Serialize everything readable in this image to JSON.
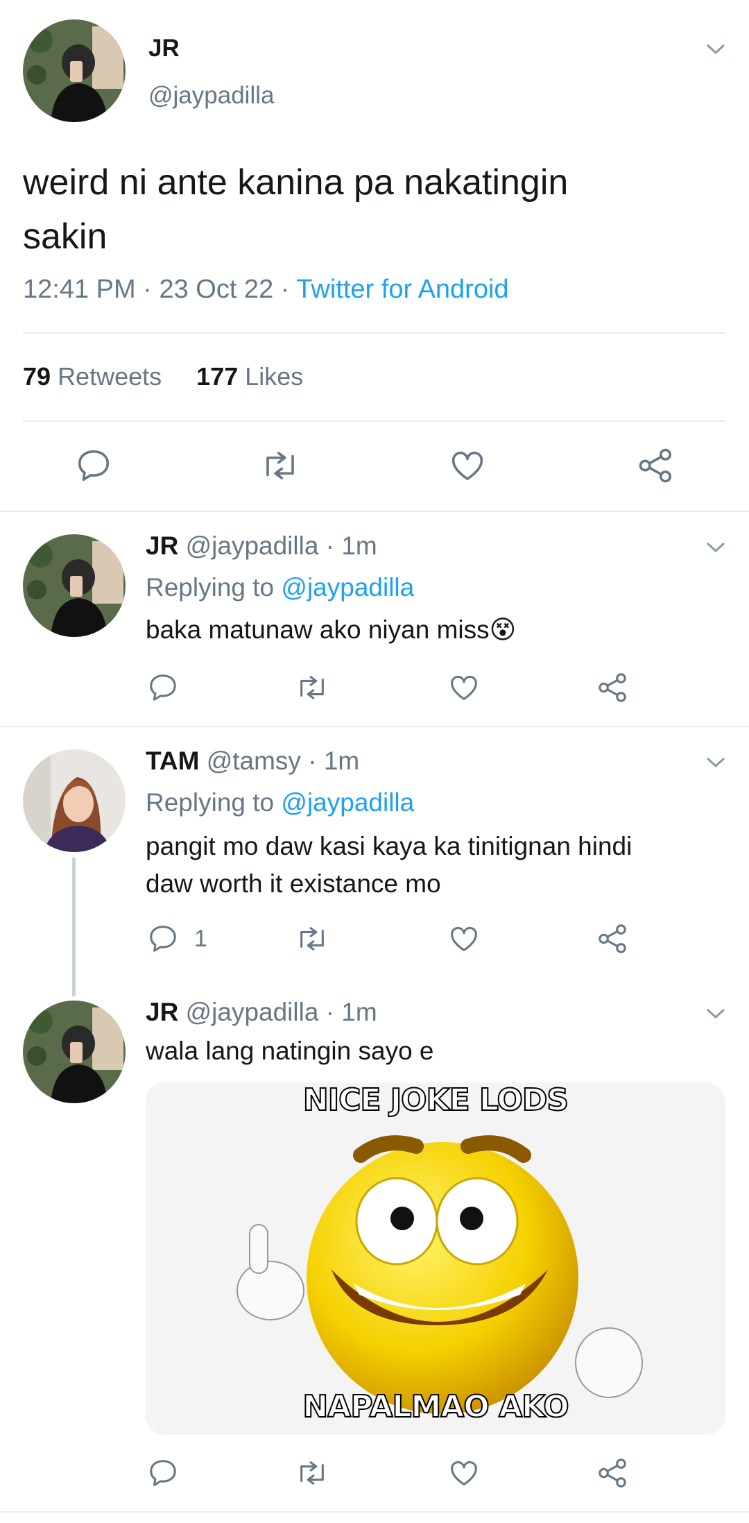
{
  "main_tweet": {
    "display_name": "JR",
    "handle": "@jaypadilla",
    "text_line1": "weird ni ante kanina pa nakatingin",
    "text_line2": "sakin",
    "time": "12:41 PM",
    "date": "23 Oct 22",
    "separator": "·",
    "source": "Twitter for Android",
    "retweets_count": "79",
    "retweets_label": "Retweets",
    "likes_count": "177",
    "likes_label": "Likes"
  },
  "replies": [
    {
      "display_name": "JR",
      "handle": "@jaypadilla",
      "time": "· 1m",
      "replying_prefix": "Replying to",
      "replying_handle": "@jaypadilla",
      "text": "baka matunaw ako niyan miss",
      "emoji": "😵"
    },
    {
      "display_name": "TAM",
      "handle": "@tamsy",
      "time": "· 1m",
      "replying_prefix": "Replying to",
      "replying_handle": "@jaypadilla",
      "text_line1": "pangit mo daw kasi kaya ka tinitignan hindi",
      "text_line2": "daw worth it existance mo",
      "reply_count": "1"
    },
    {
      "display_name": "JR",
      "handle": "@jaypadilla",
      "time": "· 1m",
      "text": "wala lang natingin sayo e",
      "meme_top_text": "NICE JOKE LODS",
      "meme_bottom_text": "NAPALMAO AKO"
    }
  ],
  "icons": [
    "reply-icon",
    "retweet-icon",
    "like-icon",
    "share-icon",
    "chevron-down-icon"
  ],
  "colors": {
    "accent": "#1da1f2",
    "secondary_text": "#657786",
    "divider": "#e6ecf0"
  }
}
